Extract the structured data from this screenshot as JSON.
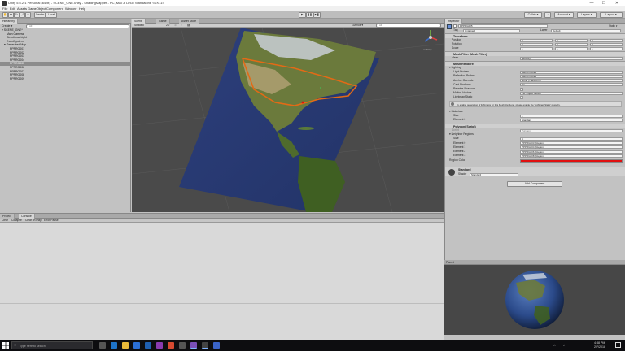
{
  "window": {
    "title": "Unity 5.6.2f1 Personal (64bit) - SCENE_GNE.unity - ShadingMapper - PC, Mac & Linux Standalone <DX11>",
    "controls": [
      "—",
      "☐",
      "✕"
    ]
  },
  "menu": [
    "File",
    "Edit",
    "Assets",
    "GameObject",
    "Component",
    "Window",
    "Help"
  ],
  "toolbar": {
    "pivot": "Center",
    "space": "Local",
    "collab": "Collab ▾",
    "account": "Account ▾",
    "layers": "Layers ▾",
    "layout": "Layout ▾"
  },
  "hierarchy": {
    "tab": "Hierarchy",
    "create": "Create ▾",
    "search_placeholder": "All",
    "items": [
      {
        "label": "▾ SCENE_GNE*",
        "indent": 0,
        "selected": false
      },
      {
        "label": "Main Camera",
        "indent": 1,
        "selected": false
      },
      {
        "label": "Directional Light",
        "indent": 1,
        "selected": false
      },
      {
        "label": "EventSystem",
        "indent": 1,
        "selected": false
      },
      {
        "label": "▾ Generated Map",
        "indent": 1,
        "selected": false
      },
      {
        "label": "PPPRG001",
        "indent": 2,
        "selected": false
      },
      {
        "label": "PPPRG002",
        "indent": 2,
        "selected": false
      },
      {
        "label": "PPPRG003",
        "indent": 2,
        "selected": false
      },
      {
        "label": "PPPRG004",
        "indent": 2,
        "selected": false
      },
      {
        "label": "PPPRG005",
        "indent": 2,
        "selected": true
      },
      {
        "label": "PPPRG006",
        "indent": 2,
        "selected": false
      },
      {
        "label": "PPPRG007",
        "indent": 2,
        "selected": false
      },
      {
        "label": "PPPRG008",
        "indent": 2,
        "selected": false
      },
      {
        "label": "PPPRG009",
        "indent": 2,
        "selected": false
      }
    ]
  },
  "scene": {
    "tabs": [
      "Scene",
      "Game",
      "Asset Store"
    ],
    "shading": "Shaded",
    "mode": "2D",
    "gizmos": "Gizmos ▾",
    "search_placeholder": "All",
    "persp": "< Persp"
  },
  "bottom": {
    "tabs": [
      "Project",
      "Console"
    ],
    "buttons": [
      "Clear",
      "Collapse",
      "Clear on Play",
      "Error Pause"
    ]
  },
  "inspector": {
    "tab": "Inspector",
    "object_name": "PPPRG005",
    "static": "Static ▾",
    "tag_label": "Tag",
    "tag_value": "Untagged",
    "layer_label": "Layer",
    "layer_value": "Default",
    "transform": {
      "title": "Transform",
      "rows": [
        {
          "label": "Position",
          "x": "0",
          "y": "0",
          "z": "0"
        },
        {
          "label": "Rotation",
          "x": "0",
          "y": "0",
          "z": "0"
        },
        {
          "label": "Scale",
          "x": "1",
          "y": "1",
          "z": "1"
        }
      ]
    },
    "mesh_filter": {
      "title": "Mesh Filter (Mesh Filter)",
      "mesh_label": "Mesh",
      "mesh_value": "geoPoly"
    },
    "mesh_renderer": {
      "title": "Mesh Renderer",
      "lighting": "▾ Lighting",
      "rows": [
        {
          "label": "Light Probes",
          "value": "Blend Probes"
        },
        {
          "label": "Reflection Probes",
          "value": "Blend Probes"
        },
        {
          "label": "Anchor Override",
          "value": "None (Transform)"
        },
        {
          "label": "Cast Shadows",
          "value": "On"
        },
        {
          "label": "Receive Shadows",
          "value": "✓"
        },
        {
          "label": "Motion Vectors",
          "value": "Per Object Motion"
        },
        {
          "label": "Lightmap Static",
          "value": ""
        }
      ],
      "note": "To enable generation of lightmaps for this Mesh Renderer, please enable the 'Lightmap Static' property.",
      "materials": "▾ Materials",
      "size_label": "Size",
      "size_value": "1",
      "element_label": "Element 0",
      "element_value": "Standard"
    },
    "polygon": {
      "title": "Polygon (Script)",
      "script_label": "Script",
      "script_value": "Polygon",
      "neighbors": "▾ Neighbor Regions",
      "size_label": "Size",
      "size_value": "4",
      "elements": [
        {
          "label": "Element 0",
          "value": "PPPRG003 (Region)"
        },
        {
          "label": "Element 1",
          "value": "PPPRG004 (Region)"
        },
        {
          "label": "Element 2",
          "value": "PPPRG006 (Region)"
        },
        {
          "label": "Element 3",
          "value": "PPPRG008 (Region)"
        }
      ],
      "region_color_label": "Region Color",
      "region_color": "#e01010"
    },
    "material": {
      "name": "Standard",
      "shader_label": "Shader",
      "shader_value": "Standard"
    },
    "add_component": "Add Component"
  },
  "preview": {
    "tab": "Inspector",
    "title": "Planet",
    "label": "Preview"
  },
  "taskbar": {
    "search": "Type here to search",
    "time": "4:38 PM",
    "date": "2/7/2018"
  }
}
